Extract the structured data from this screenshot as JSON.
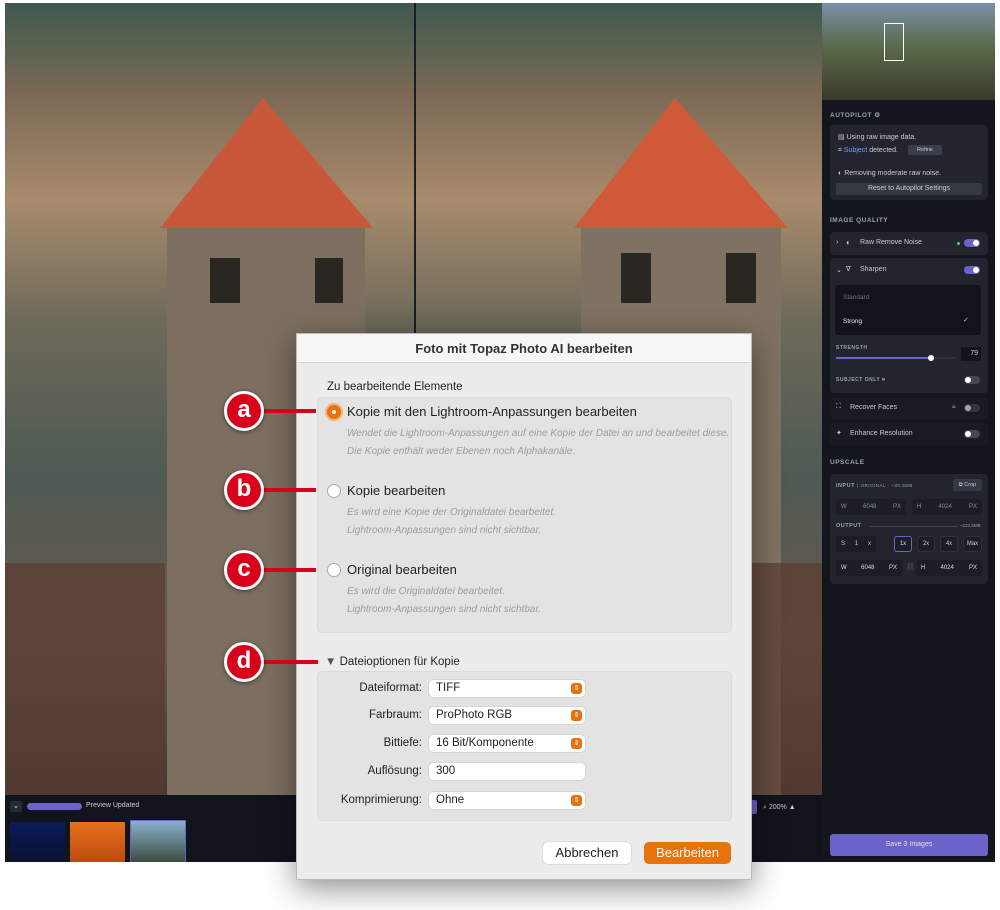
{
  "viewer": {
    "zoom": "200%",
    "status": "Preview Updated"
  },
  "panel": {
    "autopilot": {
      "title": "AUTOPILOT",
      "raw": "Using raw image data.",
      "subject_link": "Subject",
      "subject_rest": " detected.",
      "refine": "Refine",
      "noise": "Removing moderate raw noise.",
      "reset": "Reset to Autopilot Settings"
    },
    "image_quality": {
      "title": "IMAGE QUALITY",
      "raw_noise": "Raw Remove Noise",
      "sharpen": "Sharpen",
      "modes": [
        "Standard",
        "Strong"
      ],
      "selected_mode": "Strong",
      "strength_label": "STRENGTH",
      "strength": 79,
      "subject_only": "SUBJECT ONLY",
      "recover_faces": "Recover Faces",
      "enhance": "Enhance Resolution"
    },
    "upscale": {
      "title": "UPSCALE",
      "input": "INPUT",
      "input_info": "| ORIGINAL · ~30,9MB",
      "crop": "Crop",
      "in_w_label": "W",
      "in_w": "6048",
      "in_h_label": "H",
      "in_h": "4024",
      "px": "PX",
      "output": "OUTPUT",
      "output_size": "~123,6MB",
      "s_label": "S",
      "s_val": "1",
      "x": "x",
      "scales": [
        "1x",
        "2x",
        "4x",
        "Max"
      ],
      "out_w": "6048",
      "out_h": "4024"
    },
    "save": "Save 3 Images"
  },
  "dialog": {
    "title": "Foto mit Topaz Photo AI bearbeiten",
    "section": "Zu bearbeitende Elemente",
    "options": [
      {
        "label": "Kopie mit den Lightroom-Anpassungen bearbeiten",
        "desc1": "Wendet die Lightroom-Anpassungen auf eine Kopie der Datei an und bearbeitet diese.",
        "desc2": "Die Kopie enthält weder Ebenen noch Alphakanäle.",
        "callout": "a"
      },
      {
        "label": "Kopie bearbeiten",
        "desc1": "Es wird eine Kopie der Originaldatei bearbeitet.",
        "desc2": "Lightroom-Anpassungen sind nicht sichtbar.",
        "callout": "b"
      },
      {
        "label": "Original bearbeiten",
        "desc1": "Es wird die Originaldatei bearbeitet.",
        "desc2": "Lightroom-Anpassungen sind nicht sichtbar.",
        "callout": "c"
      }
    ],
    "file_options": {
      "title": "Dateioptionen für Kopie",
      "callout": "d",
      "rows": [
        {
          "label": "Dateiformat:",
          "value": "TIFF"
        },
        {
          "label": "Farbraum:",
          "value": "ProPhoto RGB"
        },
        {
          "label": "Bittiefe:",
          "value": "16 Bit/Komponente"
        },
        {
          "label": "Auflösung:",
          "value": "300"
        },
        {
          "label": "Komprimierung:",
          "value": "Ohne"
        }
      ]
    },
    "cancel": "Abbrechen",
    "ok": "Bearbeiten"
  },
  "colors": {
    "accent": "#e8720c",
    "callout": "#d9001b",
    "topaz": "#6b63c7"
  }
}
